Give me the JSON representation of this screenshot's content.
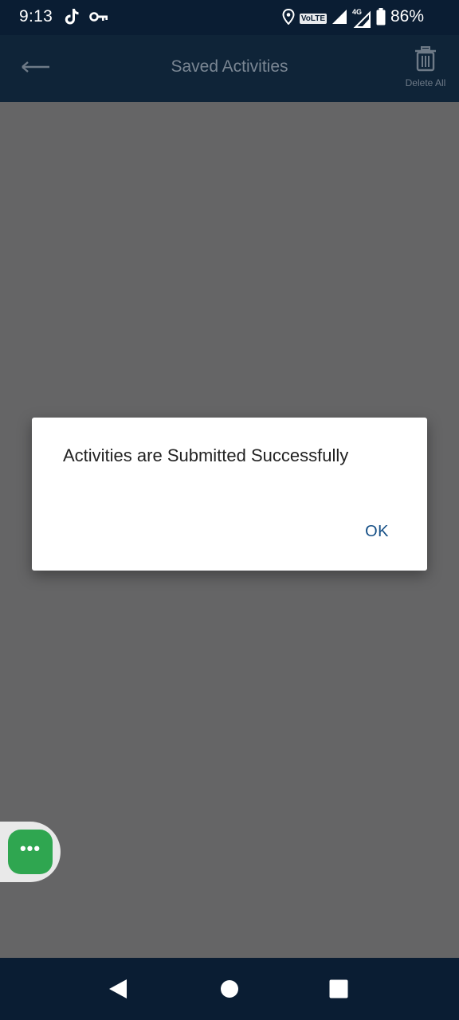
{
  "status_bar": {
    "time": "9:13",
    "network_badge": "VoLTE",
    "network_type": "4G",
    "battery": "86%",
    "left_icons": [
      "tiktok-icon",
      "vpn-key-icon"
    ],
    "right_icons": [
      "location-icon",
      "volte-icon",
      "signal-icon",
      "signal-4g-icon",
      "battery-icon"
    ]
  },
  "app_bar": {
    "title": "Saved Activities",
    "back_icon": "arrow-left-icon",
    "delete_all_label": "Delete All",
    "delete_icon": "trash-icon"
  },
  "dialog": {
    "message": "Activities are Submitted Successfully",
    "ok_label": "OK"
  },
  "floating_button": {
    "icon": "chat-dots-icon",
    "label": "•••"
  },
  "nav_bar": {
    "icons": [
      "nav-back-icon",
      "nav-home-icon",
      "nav-recents-icon"
    ]
  },
  "colors": {
    "status_bar": "#0a1d33",
    "app_bar_dimmed": "#0f2438",
    "scrim": "#656566",
    "ok_text": "#154f86",
    "fab_green": "#2fa650"
  }
}
